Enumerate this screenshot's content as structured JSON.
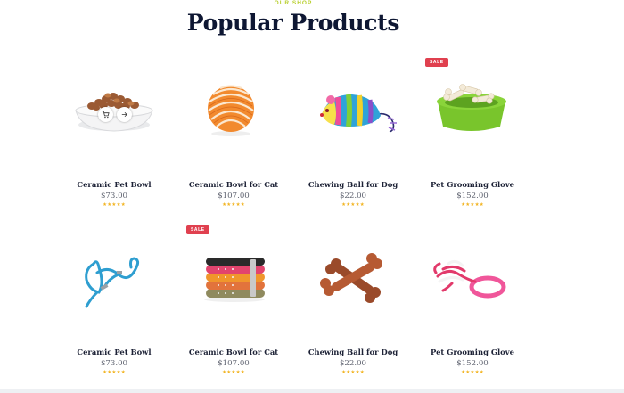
{
  "section": {
    "eyebrow": "OUR SHOP",
    "title": "Popular Products"
  },
  "colors": {
    "accent": "#b8cf2e",
    "sale": "#e0404f",
    "star": "#f2b422",
    "title": "#0e1733"
  },
  "products": [
    {
      "name": "Ceramic Pet Bowl",
      "price": "$73.00",
      "rating": 5,
      "stars": "★★★★★",
      "badge": "",
      "image": "bowl-with-kibble",
      "actions": [
        "cart-icon",
        "arrow-right-icon"
      ]
    },
    {
      "name": "Ceramic Bowl for Cat",
      "price": "$107.00",
      "rating": 5,
      "stars": "★★★★★",
      "badge": "",
      "image": "rope-ball"
    },
    {
      "name": "Chewing Ball for Dog",
      "price": "$22.00",
      "rating": 5,
      "stars": "★★★★★",
      "badge": "",
      "image": "toy-mouse"
    },
    {
      "name": "Pet Grooming Glove",
      "price": "$152.00",
      "rating": 5,
      "stars": "★★★★★",
      "badge": "SALE",
      "image": "green-bowl-with-bones"
    },
    {
      "name": "Ceramic Pet Bowl",
      "price": "$73.00",
      "rating": 5,
      "stars": "★★★★★",
      "badge": "",
      "image": "leash"
    },
    {
      "name": "Ceramic Bowl for Cat",
      "price": "$107.00",
      "rating": 5,
      "stars": "★★★★★",
      "badge": "SALE",
      "image": "stacked-collars"
    },
    {
      "name": "Chewing Ball for Dog",
      "price": "$22.00",
      "rating": 5,
      "stars": "★★★★★",
      "badge": "",
      "image": "chew-bones"
    },
    {
      "name": "Pet Grooming Glove",
      "price": "$152.00",
      "rating": 5,
      "stars": "★★★★★",
      "badge": "",
      "image": "rope-ring-toy"
    }
  ]
}
